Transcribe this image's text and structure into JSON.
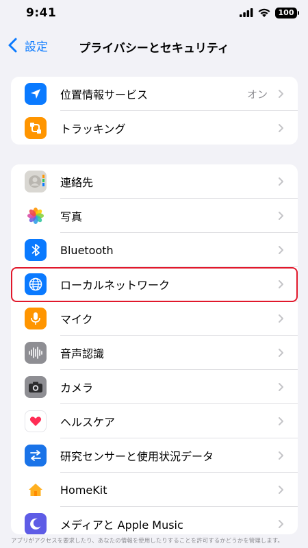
{
  "status_bar": {
    "time": "9:41",
    "battery": "100"
  },
  "nav": {
    "back_label": "設定",
    "title": "プライバシーとセキュリティ"
  },
  "group1": [
    {
      "label": "位置情報サービス",
      "value": "オン",
      "icon": "location-arrow-icon",
      "color": "#0a7aff"
    },
    {
      "label": "トラッキング",
      "value": "",
      "icon": "tracking-icon",
      "color": "#ff9500"
    }
  ],
  "group2": [
    {
      "label": "連絡先",
      "icon": "contacts-icon",
      "color": "#d9d7d2"
    },
    {
      "label": "写真",
      "icon": "photos-icon",
      "color": "#ffffff"
    },
    {
      "label": "Bluetooth",
      "icon": "bluetooth-icon",
      "color": "#0a7aff"
    },
    {
      "label": "ローカルネットワーク",
      "icon": "globe-icon",
      "color": "#0a7aff"
    },
    {
      "label": "マイク",
      "icon": "microphone-icon",
      "color": "#ff9500"
    },
    {
      "label": "音声認識",
      "icon": "waveform-icon",
      "color": "#8e8e93"
    },
    {
      "label": "カメラ",
      "icon": "camera-icon",
      "color": "#8e8e93"
    },
    {
      "label": "ヘルスケア",
      "icon": "heart-icon",
      "color": "#ffffff"
    },
    {
      "label": "研究センサーと使用状況データ",
      "icon": "research-icon",
      "color": "#1a73e8"
    },
    {
      "label": "HomeKit",
      "icon": "home-icon",
      "color": "#ffffff"
    },
    {
      "label": "メディアと Apple Music",
      "icon": "music-icon",
      "color": "#5e5ce6"
    }
  ],
  "footer": {
    "note": "アプリがアクセスを要求したり、あなたの情報を使用したりすることを許可するかどうかを管理します。"
  }
}
